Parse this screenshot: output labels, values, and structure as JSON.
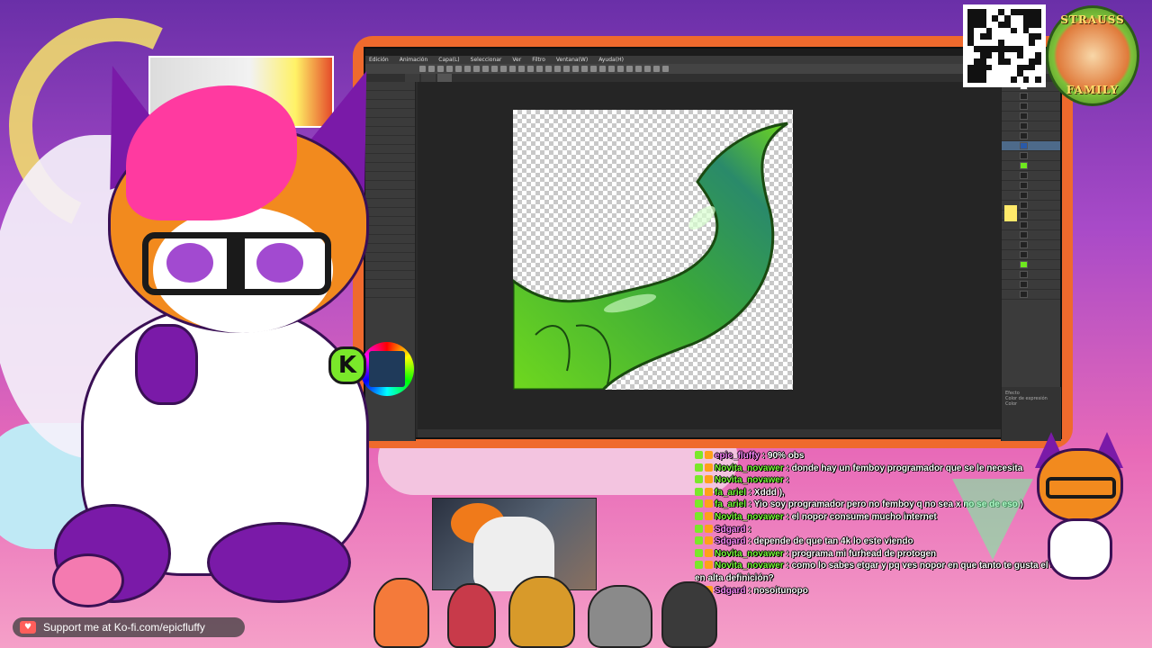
{
  "app": {
    "menu": [
      "Edición",
      "Animación",
      "Capa(L)",
      "Seleccionar",
      "Ver",
      "Filtro",
      "Ventana(W)",
      "Ayuda(H)"
    ],
    "tabs": [
      "",
      "",
      ""
    ],
    "right_panel_footer": [
      "Efecto",
      "Color de expresión",
      "Color"
    ]
  },
  "badge": {
    "top_text": "STRAUSS",
    "bottom_text": "FAMILY"
  },
  "logo_k": "K",
  "kofi": {
    "icon": "♥",
    "text": "Support me at Ko-fi.com/epicfluffy"
  },
  "chat": {
    "lines": [
      {
        "user": "epic_fluffy",
        "user_style": "alt",
        "message": " : 90% obs"
      },
      {
        "user": "Novita_novawer",
        "user_style": "",
        "message": " : donde hay un femboy programador que se le necesita"
      },
      {
        "user": "Novita_novawer",
        "user_style": "",
        "message": " : "
      },
      {
        "user": "fa_ariel",
        "user_style": "",
        "message": " : Xddd ),"
      },
      {
        "user": "fa_ariel",
        "user_style": "",
        "message": " : Yio soy programador pero no femboy q no sea x no se de eso )"
      },
      {
        "user": "Novita_novawer",
        "user_style": "",
        "message": " : el nopor consume mucho internet"
      },
      {
        "user": "Sdgard",
        "user_style": "alt",
        "message": " : "
      },
      {
        "user": "Sdgard",
        "user_style": "alt",
        "message": " : depende de que tan 4k lo este viendo"
      },
      {
        "user": "Novita_novawer",
        "user_style": "",
        "message": " : programa mi furhead de protogen"
      },
      {
        "user": "Novita_novawer",
        "user_style": "",
        "message": " : como lo sabes etgar y pq ves nopor en que tanto te gusta el liquido fluido en alta definición?"
      },
      {
        "user": "Sdgard",
        "user_style": "alt",
        "message": " : nosoitunopo"
      }
    ]
  },
  "colors": {
    "accent_orange": "#ef6a2d",
    "chat_user_green": "#7aff3a",
    "chat_user_pink": "#ff8aff",
    "kofi_red": "#ff5e5b"
  }
}
